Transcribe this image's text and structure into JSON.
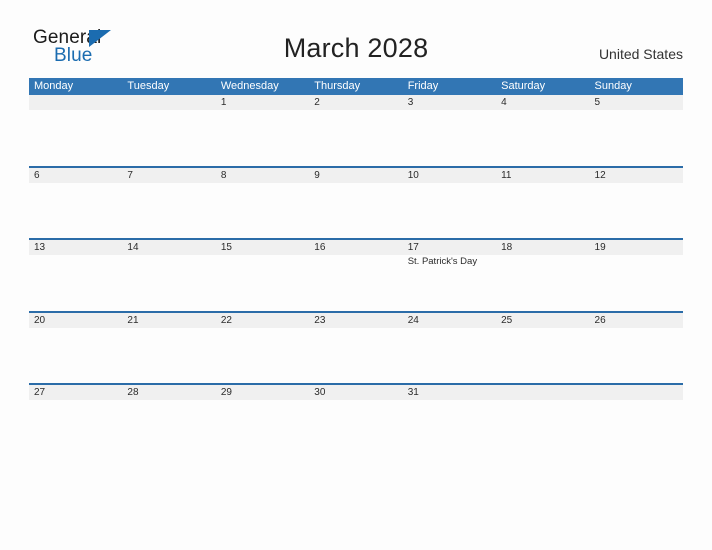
{
  "brand": {
    "name_part1": "General",
    "name_part2": "Blue",
    "triangle_icon": "triangle-icon",
    "accent_color": "#1b6cb0"
  },
  "header": {
    "title": "March 2028",
    "country": "United States"
  },
  "calendar": {
    "header_bg_color": "#3276b4",
    "row_divider_color": "#2b6ca8",
    "date_band_color": "#f0f0f0",
    "weekdays": [
      "Monday",
      "Tuesday",
      "Wednesday",
      "Thursday",
      "Friday",
      "Saturday",
      "Sunday"
    ],
    "weeks": [
      [
        {
          "date": "",
          "events": []
        },
        {
          "date": "",
          "events": []
        },
        {
          "date": "1",
          "events": []
        },
        {
          "date": "2",
          "events": []
        },
        {
          "date": "3",
          "events": []
        },
        {
          "date": "4",
          "events": []
        },
        {
          "date": "5",
          "events": []
        }
      ],
      [
        {
          "date": "6",
          "events": []
        },
        {
          "date": "7",
          "events": []
        },
        {
          "date": "8",
          "events": []
        },
        {
          "date": "9",
          "events": []
        },
        {
          "date": "10",
          "events": []
        },
        {
          "date": "11",
          "events": []
        },
        {
          "date": "12",
          "events": []
        }
      ],
      [
        {
          "date": "13",
          "events": []
        },
        {
          "date": "14",
          "events": []
        },
        {
          "date": "15",
          "events": []
        },
        {
          "date": "16",
          "events": []
        },
        {
          "date": "17",
          "events": [
            "St. Patrick's Day"
          ]
        },
        {
          "date": "18",
          "events": []
        },
        {
          "date": "19",
          "events": []
        }
      ],
      [
        {
          "date": "20",
          "events": []
        },
        {
          "date": "21",
          "events": []
        },
        {
          "date": "22",
          "events": []
        },
        {
          "date": "23",
          "events": []
        },
        {
          "date": "24",
          "events": []
        },
        {
          "date": "25",
          "events": []
        },
        {
          "date": "26",
          "events": []
        }
      ],
      [
        {
          "date": "27",
          "events": []
        },
        {
          "date": "28",
          "events": []
        },
        {
          "date": "29",
          "events": []
        },
        {
          "date": "30",
          "events": []
        },
        {
          "date": "31",
          "events": []
        },
        {
          "date": "",
          "events": []
        },
        {
          "date": "",
          "events": []
        }
      ]
    ]
  }
}
